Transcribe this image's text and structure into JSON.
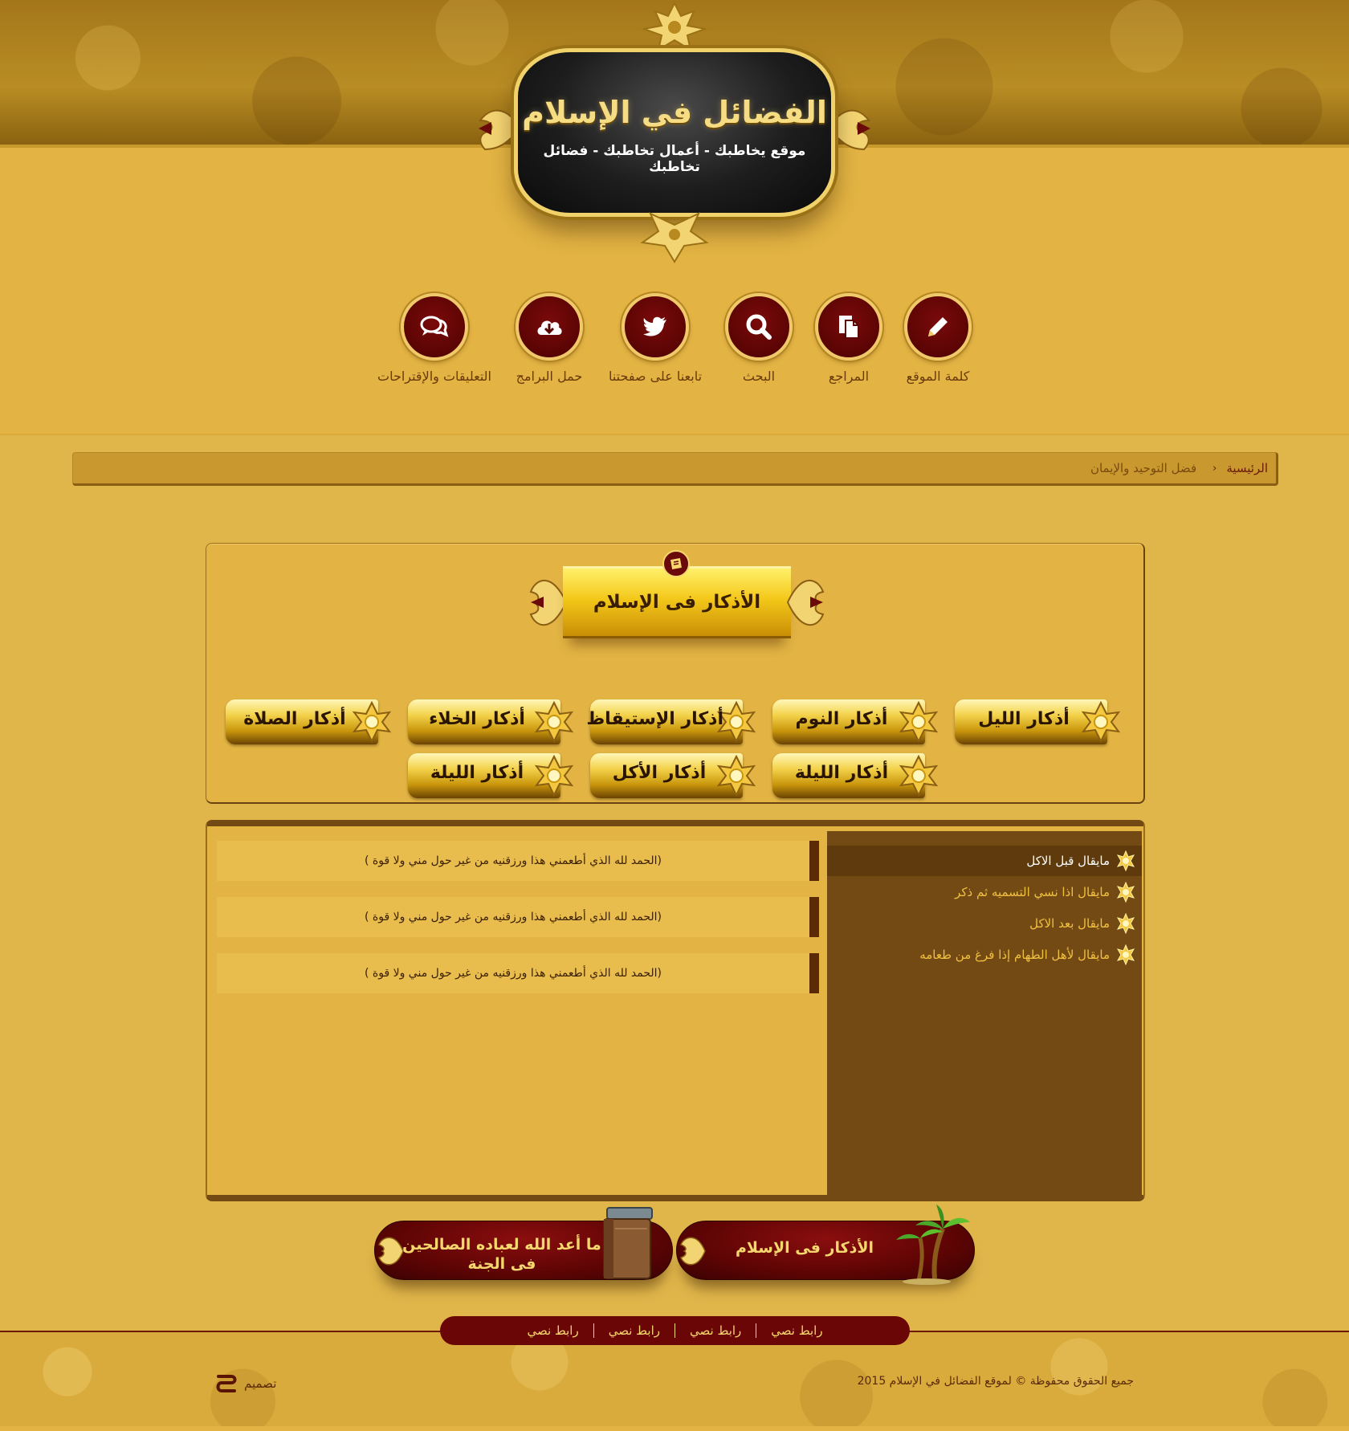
{
  "site": {
    "title": "الفضائل في الإسلام",
    "tagline": "موقع يخاطبك - أعمال تخاطبك - فضائل تخاطبك"
  },
  "nav": [
    {
      "label": "كلمة الموقع",
      "icon": "pencil-icon"
    },
    {
      "label": "المراجع",
      "icon": "documents-icon"
    },
    {
      "label": "البحث",
      "icon": "search-icon"
    },
    {
      "label": "تابعنا على صفحتنا",
      "icon": "twitter-icon"
    },
    {
      "label": "حمل البرامج",
      "icon": "cloud-download-icon"
    },
    {
      "label": "التعليقات والإقتراحات",
      "icon": "comments-icon"
    }
  ],
  "breadcrumb": {
    "home": "الرئيسية",
    "current": "فضل التوحيد والإيمان"
  },
  "azkar": {
    "title": "الأذكار فى الإسلام",
    "buttons": [
      "أذكار الليل",
      "أذكار النوم",
      "أذكار الإستيقاظ",
      "أذكار الخلاء",
      "أذكار الصلاة",
      "أذكار الليلة",
      "أذكار الأكل",
      "أذكار الليلة"
    ]
  },
  "sidebar": {
    "items": [
      "مايقال قبل الاكل",
      "مايقال اذا نسي التسميه ثم ذكر",
      "مايقال بعد الاكل",
      "مايقال لأهل الطهام إذا فرغ من طعامه"
    ],
    "active_index": 0
  },
  "content": {
    "rows": [
      "(الحمد لله الذي أطعمني هذا ورزقنيه من غير حول مني ولا قوة )",
      "(الحمد لله الذي أطعمني هذا ورزقنيه من غير حول مني ولا قوة )",
      "(الحمد لله الذي أطعمني هذا ورزقنيه من غير حول مني ولا قوة )"
    ]
  },
  "promos": [
    {
      "text": "الأذكار فى الإسلام",
      "icon": "palm-tree-icon"
    },
    {
      "text": "ما أعد الله لعباده الصالحين فى الجنة",
      "icon": "books-icon"
    }
  ],
  "footer": {
    "links": [
      "رابط نصي",
      "رابط نصي",
      "رابط نصي",
      "رابط نصي"
    ],
    "copyright": "جميع الحقوق محفوظة © لموقع الفضائل في الإسلام 2015",
    "design_label": "تصميم"
  },
  "colors": {
    "page_bg": "#e0b64a",
    "maroon": "#5e0404",
    "gold": "#f6d76e",
    "sidebar_brown": "#744a14"
  }
}
